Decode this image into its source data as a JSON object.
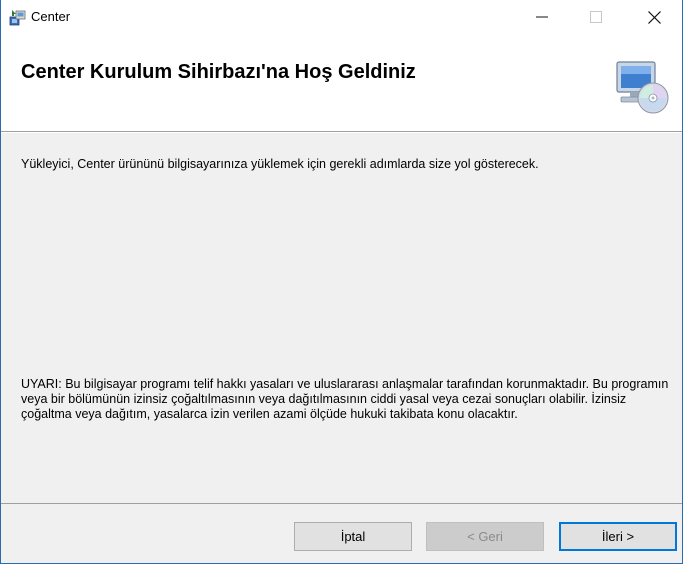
{
  "window": {
    "title": "Center",
    "minimize_glyph": "—",
    "maximize_glyph": "☐",
    "close_glyph": "✕"
  },
  "banner": {
    "title": "Center Kurulum Sihirbazı'na Hoş Geldiniz",
    "icon": "computer-cd-icon"
  },
  "content": {
    "intro": "Yükleyici, Center ürününü bilgisayarınıza yüklemek için gerekli adımlarda size yol gösterecek.",
    "warning": "UYARI: Bu bilgisayar programı telif hakkı yasaları ve uluslararası anlaşmalar tarafından korunmaktadır. Bu programın veya bir bölümünün izinsiz çoğaltılmasının veya dağıtılmasının ciddi yasal veya cezai sonuçları olabilir. İzinsiz çoğaltma veya dağıtım, yasalarca izin verilen azami ölçüde hukuki takibata konu olacaktır."
  },
  "buttons": {
    "cancel": "İptal",
    "back": "< Geri",
    "next": "İleri >"
  },
  "colors": {
    "window_border": "#2b6cb0",
    "panel_bg": "#f0f0f0",
    "button_bg": "#e1e1e1",
    "default_button_border": "#0078d7",
    "disabled_text": "#8a8a8a"
  }
}
